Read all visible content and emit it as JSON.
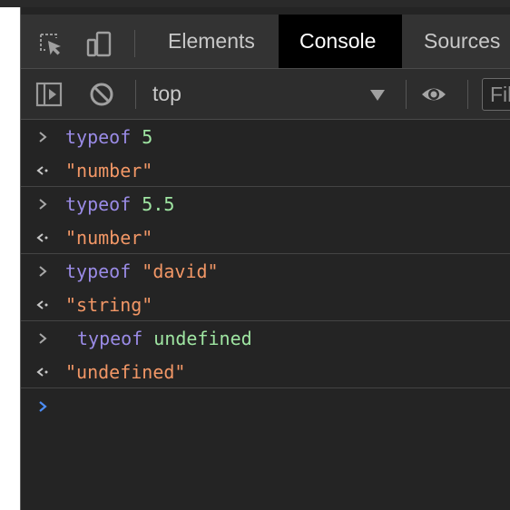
{
  "tabs": [
    {
      "label": "Elements",
      "active": false
    },
    {
      "label": "Console",
      "active": true
    },
    {
      "label": "Sources",
      "active": false
    }
  ],
  "toolbar": {
    "context": "top",
    "filter_placeholder": "Fil"
  },
  "entries": [
    {
      "input_keyword": "typeof",
      "input_arg": "5",
      "output": "\"number\""
    },
    {
      "input_keyword": "typeof",
      "input_arg": "5.5",
      "output": "\"number\""
    },
    {
      "input_keyword": "typeof",
      "input_arg": "\"david\"",
      "output": "\"string\""
    },
    {
      "input_keyword": "typeof",
      "input_arg": "undefined",
      "output": "\"undefined\""
    }
  ],
  "icons": {
    "inspect": "inspect-element-icon",
    "device": "device-toolbar-icon",
    "sidebar": "show-sidebar-icon",
    "clear": "clear-console-icon",
    "eye": "live-expression-eye-icon",
    "input_prompt": "chevron-right-icon",
    "output_prompt": "return-arrow-icon"
  },
  "colors": {
    "panel_bg": "#242424",
    "active_tab_bg": "#000000",
    "keyword": "#9a8be6",
    "number": "#9fe5a2",
    "string": "#f29766",
    "prompt_active": "#4c8df6"
  }
}
